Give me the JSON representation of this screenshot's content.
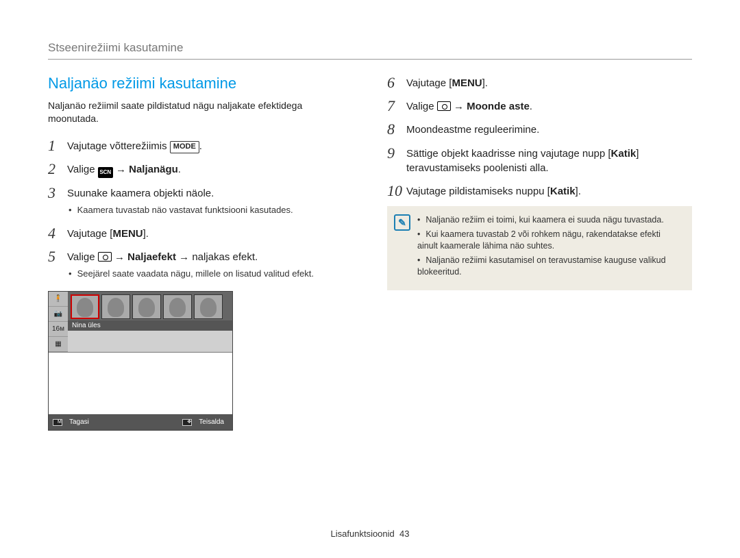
{
  "section_label": "Stseenirežiimi kasutamine",
  "subheading": "Naljanäo režiimi kasutamine",
  "intro": "Naljanäo režiimil saate pildistatud nägu naljakate efektidega moonutada.",
  "left_steps": [
    {
      "n": "1",
      "parts": [
        {
          "t": "Vajutage võtterežiimis "
        },
        {
          "icon": "mode"
        },
        {
          "t": "."
        }
      ]
    },
    {
      "n": "2",
      "parts": [
        {
          "t": "Valige "
        },
        {
          "icon": "scn"
        },
        {
          "t": " "
        },
        {
          "arrow": true
        },
        {
          "t": " "
        },
        {
          "bold": "Naljanägu"
        },
        {
          "t": "."
        }
      ]
    },
    {
      "n": "3",
      "parts": [
        {
          "t": "Suunake kaamera objekti näole."
        }
      ],
      "sub": [
        "Kaamera tuvastab näo vastavat funktsiooni kasutades."
      ]
    },
    {
      "n": "4",
      "parts": [
        {
          "t": "Vajutage ["
        },
        {
          "menu": true
        },
        {
          "t": "]."
        }
      ]
    },
    {
      "n": "5",
      "parts": [
        {
          "t": "Valige "
        },
        {
          "icon": "cam"
        },
        {
          "t": " "
        },
        {
          "arrow": true
        },
        {
          "t": " "
        },
        {
          "bold": "Naljaefekt"
        },
        {
          "t": " "
        },
        {
          "arrow": true
        },
        {
          "t": " naljakas efekt."
        }
      ],
      "sub": [
        "Seejärel saate vaadata nägu, millele on lisatud valitud efekt."
      ]
    }
  ],
  "lcd": {
    "caption": "Nina üles",
    "foot_back_label": "Tagasi",
    "foot_move_label": "Teisalda"
  },
  "right_steps": [
    {
      "n": "6",
      "parts": [
        {
          "t": "Vajutage ["
        },
        {
          "menu": true
        },
        {
          "t": "]."
        }
      ]
    },
    {
      "n": "7",
      "parts": [
        {
          "t": "Valige "
        },
        {
          "icon": "cam"
        },
        {
          "t": " "
        },
        {
          "arrow": true
        },
        {
          "t": " "
        },
        {
          "bold": "Moonde aste"
        },
        {
          "t": "."
        }
      ]
    },
    {
      "n": "8",
      "parts": [
        {
          "t": "Moondeastme reguleerimine."
        }
      ]
    },
    {
      "n": "9",
      "parts": [
        {
          "t": "Sättige objekt kaadrisse ning vajutage nupp ["
        },
        {
          "bold": "Katik"
        },
        {
          "t": "] teravustamiseks poolenisti alla."
        }
      ]
    },
    {
      "n": "10",
      "parts": [
        {
          "t": "Vajutage pildistamiseks nuppu ["
        },
        {
          "bold": "Katik"
        },
        {
          "t": "]."
        }
      ]
    }
  ],
  "notes": [
    "Naljanäo režiim ei toimi, kui kaamera ei suuda nägu tuvastada.",
    "Kui kaamera tuvastab 2 või rohkem nägu, rakendatakse efekti ainult kaamerale lähima näo suhtes.",
    "Naljanäo režiimi kasutamisel on teravustamise kauguse valikud blokeeritud."
  ],
  "footer_label": "Lisafunktsioonid",
  "footer_page": "43",
  "icon_text": {
    "mode": "MODE",
    "menu": "MENU",
    "scn": "SCN"
  }
}
